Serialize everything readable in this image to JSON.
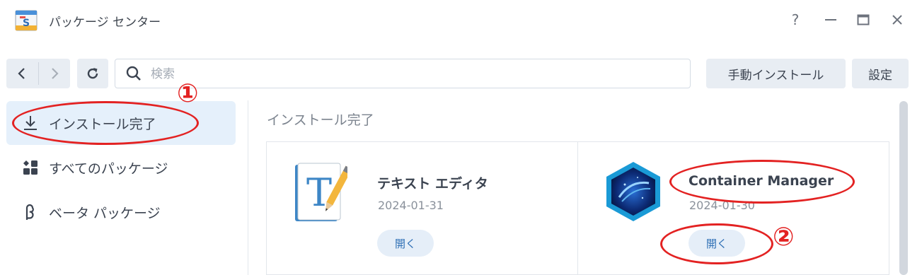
{
  "window": {
    "title": "パッケージ センター",
    "app_icon": "package-center-icon",
    "controls": {
      "help": "?",
      "minimize": "minimize-icon",
      "maximize": "maximize-icon",
      "close": "close-icon"
    }
  },
  "toolbar": {
    "search_placeholder": "検索",
    "manual_install_label": "手動インストール",
    "settings_label": "設定"
  },
  "sidebar": {
    "items": [
      {
        "label": "インストール完了",
        "icon": "download-icon",
        "active": true
      },
      {
        "label": "すべてのパッケージ",
        "icon": "grid-icon",
        "active": false
      },
      {
        "label": "ベータ パッケージ",
        "icon": "beta-icon",
        "active": false
      }
    ]
  },
  "main": {
    "section_title": "インストール完了",
    "packages": [
      {
        "name": "テキスト エディタ",
        "date": "2024-01-31",
        "action": "開く",
        "icon": "text-editor-icon"
      },
      {
        "name": "Container Manager",
        "date": "2024-01-30",
        "action": "開く",
        "icon": "container-manager-icon"
      }
    ]
  },
  "annotations": {
    "marker1": "①",
    "marker2": "②",
    "color": "#e32222"
  },
  "colors": {
    "accent": "#2e6fb5",
    "active_bg": "#e5f0fb",
    "button_bg": "#e8edf3"
  }
}
